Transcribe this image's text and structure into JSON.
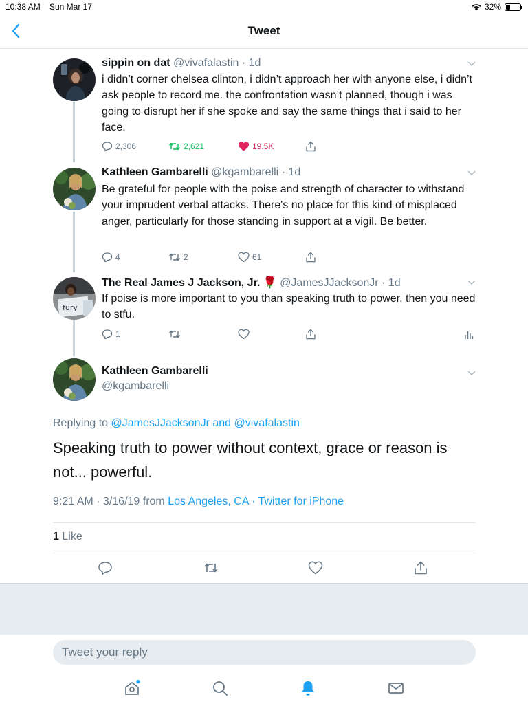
{
  "status_bar": {
    "time": "10:38 AM",
    "date": "Sun Mar 17",
    "battery": "32%",
    "battery_level": 0.32
  },
  "nav": {
    "title": "Tweet",
    "back_icon": "chevron-left-icon"
  },
  "tweets": [
    {
      "name": "sippin on dat",
      "handle": "@vivafalastin",
      "time": "· 1d",
      "text": "i didn’t corner chelsea clinton, i didn’t approach her with anyone else, i didn’t ask people to record me. the confrontation wasn’t planned, though i was going to disrupt her if she spoke and say the same things that i said to her face.",
      "replies": "2,306",
      "retweets": "2,621",
      "likes": "19.5K"
    },
    {
      "name": "Kathleen Gambarelli",
      "handle": "@kgambarelli",
      "time": "· 1d",
      "text": "Be grateful for people with the poise and strength of character to withstand your imprudent verbal attacks. There's no place for this kind of misplaced anger, particularly for those standing in support at a vigil. Be better.",
      "replies": "4",
      "retweets": "2",
      "likes": "61"
    },
    {
      "name": "The Real James J Jackson, Jr. 🌹",
      "handle": "@JamesJJacksonJr",
      "time": "· 1d",
      "text": "If poise is more important to you than speaking truth to power, then you need to stfu.",
      "replies": "1",
      "retweets": "",
      "likes": ""
    }
  ],
  "main_tweet": {
    "name": "Kathleen Gambarelli",
    "handle": "@kgambarelli",
    "replying_prefix": "Replying to",
    "replying_user1": "@JamesJJacksonJr",
    "replying_and": "and",
    "replying_user2": "@vivafalastin",
    "text": "Speaking truth to power without context, grace or reason is not... powerful.",
    "timestamp": "9:21 AM · 3/16/19 from",
    "location": "Los Angeles, CA",
    "source": "· Twitter for iPhone",
    "likes_count": "1",
    "likes_label": "Like"
  },
  "reply": {
    "placeholder": "Tweet your reply"
  },
  "colors": {
    "accent": "#1da1f2",
    "retweet": "#17bf63",
    "like": "#e0245e",
    "secondary": "#657786"
  }
}
